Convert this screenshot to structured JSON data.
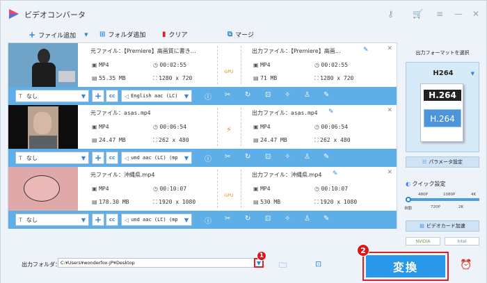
{
  "app": {
    "title": "ビデオコンバータ"
  },
  "toolbar": {
    "add_file": "ファイル追加",
    "add_folder": "フォルダ追加",
    "clear": "クリア",
    "merge": "マージ"
  },
  "labels": {
    "source": "元ファイル：",
    "output": "出力ファイル："
  },
  "items": [
    {
      "src_name": "【Premiere】高画質に書き…",
      "out_name": "【Premiere】高画…",
      "src_fmt": "MP4",
      "src_dur": "00:02:55",
      "src_size": "55.35 MB",
      "src_res": "1280 x 720",
      "out_fmt": "MP4",
      "out_dur": "00:02:55",
      "out_size": "71 MB",
      "out_res": "1280 x 720",
      "mid": "GPU",
      "subtitle": "なし",
      "audio": "English aac (LC)"
    },
    {
      "src_name": "asas.mp4",
      "out_name": "asas.mp4",
      "src_fmt": "MP4",
      "src_dur": "00:06:54",
      "src_size": "24.47 MB",
      "src_res": "262 x 480",
      "out_fmt": "MP4",
      "out_dur": "00:06:54",
      "out_size": "24.47 MB",
      "out_res": "262 x 480",
      "mid": "⚡",
      "subtitle": "なし",
      "audio": "und aac (LC) (mp"
    },
    {
      "src_name": "沖縄県.mp4",
      "out_name": "沖縄県.mp4",
      "src_fmt": "MP4",
      "src_dur": "00:10:07",
      "src_size": "178.30 MB",
      "src_res": "1920 x 1080",
      "out_fmt": "MP4",
      "out_dur": "00:10:07",
      "out_size": "530 MB",
      "out_res": "1920 x 1080",
      "mid": "GPU",
      "subtitle": "なし",
      "audio": "und aac (LC) (mp"
    }
  ],
  "sidebar": {
    "heading": "出力フォーマットを選択",
    "format": "H264",
    "disc_top": "H.264",
    "disc_bottom": "H.264",
    "param": "パラメータ設定",
    "quick": "クイック設定",
    "q_top": [
      "480P",
      "1080P",
      "4K"
    ],
    "q_bottom": [
      "自動",
      "720P",
      "2K"
    ],
    "accel": "ビデオカード加速",
    "nvidia": "NVIDIA",
    "intel": "Intel"
  },
  "bottom": {
    "out_label": "出力フォルダ：",
    "path": "C:¥Users¥wonderfox-JP¥Desktop",
    "badge1": "1",
    "badge2": "2",
    "convert": "変換"
  },
  "colors": {
    "accent": "#2998e8",
    "bar": "#5eaee8",
    "highlight": "#e02020"
  }
}
